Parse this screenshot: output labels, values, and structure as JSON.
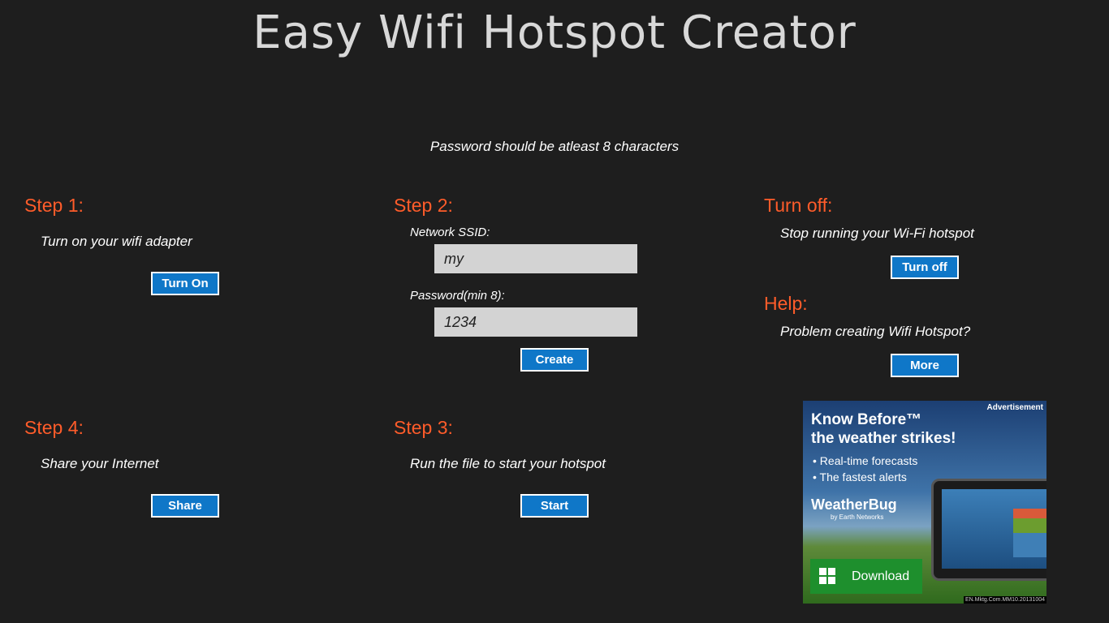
{
  "app": {
    "title": "Easy Wifi Hotspot Creator",
    "notice": "Password should be atleast 8 characters"
  },
  "step1": {
    "heading": "Step 1:",
    "description": "Turn on your wifi adapter",
    "button": "Turn On"
  },
  "step2": {
    "heading": "Step 2:",
    "ssid_label": "Network SSID:",
    "ssid_value": "my",
    "password_label": "Password(min 8):",
    "password_value": "1234",
    "button": "Create"
  },
  "step3": {
    "heading": "Step 3:",
    "description": "Run the file to start your hotspot",
    "button": "Start"
  },
  "step4": {
    "heading": "Step 4:",
    "description": "Share your Internet",
    "button": "Share"
  },
  "turnoff": {
    "heading": "Turn off:",
    "description": "Stop running your Wi-Fi hotspot",
    "button": "Turn off"
  },
  "help": {
    "heading": "Help:",
    "description": "Problem creating Wifi Hotspot?",
    "button": "More"
  },
  "ad": {
    "tag": "Advertisement",
    "headline_1": "Know Before™",
    "headline_2": "the weather strikes!",
    "bullet_1": "• Real-time forecasts",
    "bullet_2": "• The fastest alerts",
    "brand": "WeatherBug",
    "brand_sub": "by Earth Networks",
    "download": "Download",
    "code": "EN.Mktg.Com.MM10.20131004"
  },
  "colors": {
    "background": "#1e1e1e",
    "heading": "#ff5c2a",
    "button": "#0f77c8",
    "title": "#d8d8d8"
  }
}
